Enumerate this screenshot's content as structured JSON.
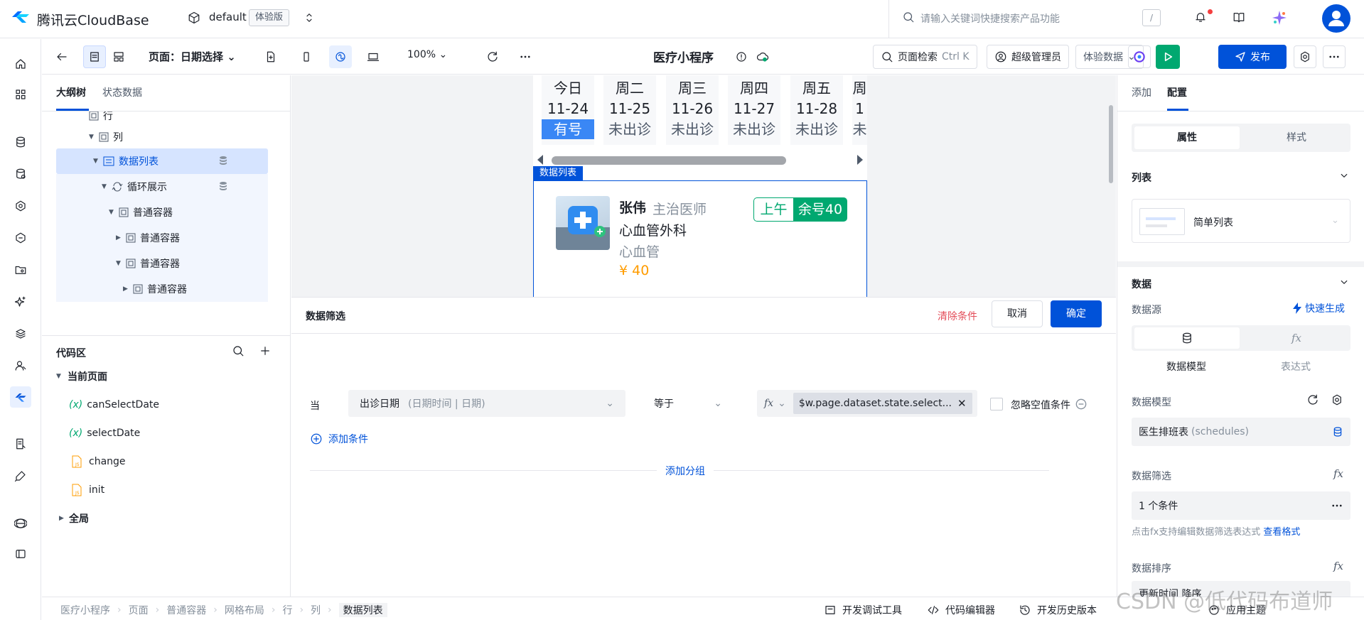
{
  "header": {
    "brand": "腾讯云CloudBase",
    "env_name": "default",
    "env_badge": "体验版",
    "search_placeholder": "请输入关键词快捷搜索产品功能",
    "search_key": "/"
  },
  "toolbar": {
    "page_label": "页面：日期选择",
    "zoom": "100%",
    "app_title": "医疗小程序",
    "page_search": "页面检索",
    "page_search_key": "Ctrl K",
    "admin": "超级管理员",
    "trial_data": "体验数据",
    "publish": "发布"
  },
  "outline": {
    "tabs": [
      "大纲树",
      "状态数据"
    ],
    "items": [
      {
        "label": "行"
      },
      {
        "label": "列"
      },
      {
        "label": "数据列表"
      },
      {
        "label": "循环展示"
      },
      {
        "label": "普通容器"
      },
      {
        "label": "普通容器"
      },
      {
        "label": "普通容器"
      },
      {
        "label": "普通容器"
      }
    ]
  },
  "code": {
    "title": "代码区",
    "current_page": "当前页面",
    "items": [
      "canSelectDate",
      "selectDate",
      "change",
      "init"
    ],
    "var_prefix": "(x)",
    "global": "全局"
  },
  "calendar": {
    "days": [
      {
        "label": "今日",
        "date": "11-24",
        "status": "有号"
      },
      {
        "label": "周二",
        "date": "11-25",
        "status": "未出诊"
      },
      {
        "label": "周三",
        "date": "11-26",
        "status": "未出诊"
      },
      {
        "label": "周四",
        "date": "11-27",
        "status": "未出诊"
      },
      {
        "label": "周五",
        "date": "11-28",
        "status": "未出诊"
      },
      {
        "label": "周",
        "date": "1",
        "status": "未"
      }
    ]
  },
  "doctor_card": {
    "list_badge": "数据列表",
    "name": "张伟",
    "title": "主治医师",
    "dept": "心血管外科",
    "subdept": "心血管",
    "price": "¥ 40",
    "slot_time": "上午",
    "slot_rest": "余号40"
  },
  "filter": {
    "title": "数据筛选",
    "clear": "清除条件",
    "cancel": "取消",
    "ok": "确定",
    "when": "当",
    "field": "出诊日期",
    "field_type": "(日期时间 | 日期)",
    "operator": "等于",
    "value_expr": "$w.page.dataset.state.select...",
    "ignore_empty": "忽略空值条件",
    "add_condition": "添加条件",
    "add_group": "添加分组"
  },
  "props": {
    "tabs": [
      "添加",
      "配置"
    ],
    "seg": [
      "属性",
      "样式"
    ],
    "list_section": "列表",
    "list_type": "简单列表",
    "data_section": "数据",
    "data_source": "数据源",
    "quick_gen": "快速生成",
    "src_model": "数据模型",
    "src_expr": "表达式",
    "model_label": "数据模型",
    "model_value": "医生排班表",
    "model_code": "(schedules)",
    "filter_label": "数据筛选",
    "filter_value": "1 个条件",
    "filter_hint": "点击fx支持编辑数据筛选表达式",
    "filter_hint_link": "查看格式",
    "sort_label": "数据排序",
    "sort_value": "更新时间 降序"
  },
  "statusbar": {
    "crumbs": [
      "医疗小程序",
      "页面",
      "普通容器",
      "网格布局",
      "行",
      "列",
      "数据列表"
    ],
    "debug": "开发调试工具",
    "code_editor": "代码编辑器",
    "history": "开发历史版本",
    "theme": "应用主题"
  },
  "watermark": "CSDN @低代码布道师",
  "colors": {
    "primary": "#0052d9",
    "success": "#00a870",
    "danger": "#e34d59",
    "price": "#ff9c00"
  }
}
